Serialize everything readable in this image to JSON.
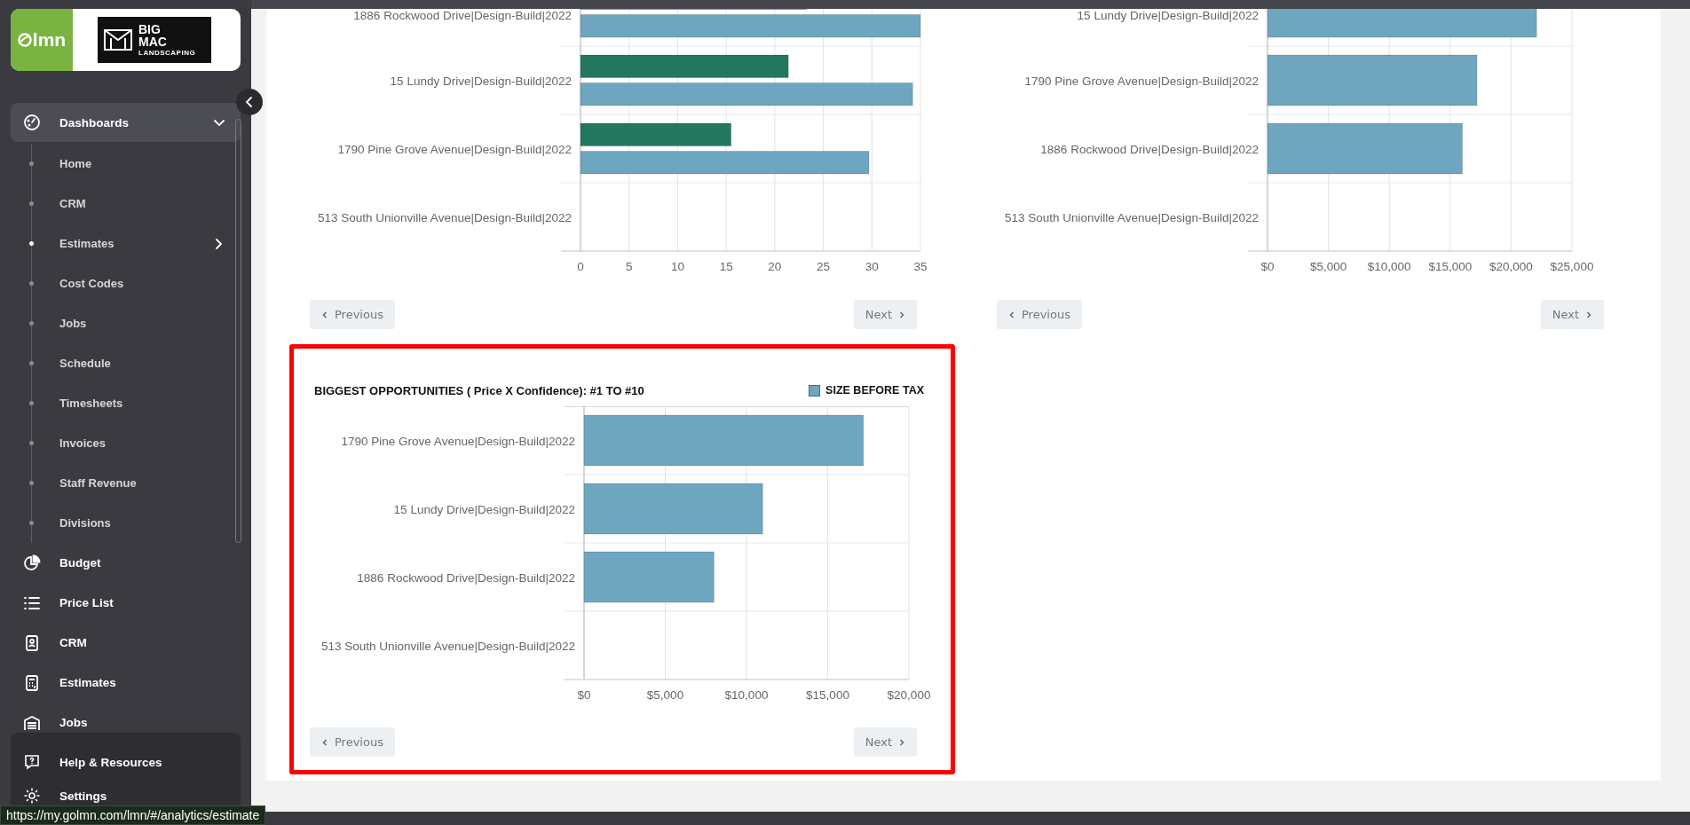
{
  "brand": {
    "logo_text": "lmn",
    "company_lines": [
      "BIG",
      "MAC",
      "LANDSCAPING"
    ]
  },
  "sidebar": {
    "items": [
      {
        "label": "Dashboards",
        "kind": "group",
        "selected": true,
        "expanded": true,
        "children": [
          {
            "label": "Home",
            "selected": false,
            "has_submenu": false
          },
          {
            "label": "CRM",
            "selected": false,
            "has_submenu": false
          },
          {
            "label": "Estimates",
            "selected": true,
            "has_submenu": true
          },
          {
            "label": "Cost Codes",
            "selected": false,
            "has_submenu": false
          },
          {
            "label": "Jobs",
            "selected": false,
            "has_submenu": false
          },
          {
            "label": "Schedule",
            "selected": false,
            "has_submenu": false
          },
          {
            "label": "Timesheets",
            "selected": false,
            "has_submenu": false
          },
          {
            "label": "Invoices",
            "selected": false,
            "has_submenu": false
          },
          {
            "label": "Staff Revenue",
            "selected": false,
            "has_submenu": false
          },
          {
            "label": "Divisions",
            "selected": false,
            "has_submenu": false
          }
        ]
      },
      {
        "label": "Budget",
        "kind": "link",
        "selected": false
      },
      {
        "label": "Price List",
        "kind": "link",
        "selected": false
      },
      {
        "label": "CRM",
        "kind": "link",
        "selected": false
      },
      {
        "label": "Estimates",
        "kind": "link",
        "selected": false
      },
      {
        "label": "Jobs",
        "kind": "link",
        "selected": false
      }
    ],
    "footer_items": [
      {
        "label": "Help & Resources"
      },
      {
        "label": "Settings"
      }
    ]
  },
  "charts": [
    {
      "highlighted": false,
      "chart_data": {
        "type": "bar",
        "orientation": "horizontal",
        "categories": [
          "1886 Rockwood Drive|Design-Build|2022",
          "15 Lundy Drive|Design-Build|2022",
          "1790 Pine Grove Avenue|Design-Build|2022",
          "513 South Unionville Avenue|Design-Build|2022"
        ],
        "series": [
          {
            "color": "#23775f",
            "values": [
              23.3,
              21.4,
              15.5,
              null
            ]
          },
          {
            "color": "#6ea6bf",
            "values": [
              35,
              34.2,
              29.7,
              null
            ]
          }
        ],
        "xlim": [
          0,
          35
        ],
        "grid": true,
        "xticks": [
          0,
          5,
          10,
          15,
          20,
          25,
          30,
          35
        ]
      },
      "buttons": [
        {
          "label": "Previous",
          "kind": "previous"
        },
        {
          "label": "Next",
          "kind": "next"
        }
      ]
    },
    {
      "highlighted": false,
      "chart_data": {
        "type": "bar",
        "orientation": "horizontal",
        "categories": [
          "15 Lundy Drive|Design-Build|2022",
          "1790 Pine Grove Avenue|Design-Build|2022",
          "1886 Rockwood Drive|Design-Build|2022",
          "513 South Unionville Avenue|Design-Build|2022"
        ],
        "series": [
          {
            "color": "#6ea6bf",
            "values": [
              22100,
              17200,
              16000,
              null
            ]
          }
        ],
        "xlim": [
          0,
          25000
        ],
        "grid": true,
        "xticks": [
          {
            "value": 0,
            "label": "$0"
          },
          {
            "value": 5000,
            "label": "$5,000"
          },
          {
            "value": 10000,
            "label": "$10,000"
          },
          {
            "value": 15000,
            "label": "$15,000"
          },
          {
            "value": 20000,
            "label": "$20,000"
          },
          {
            "value": 25000,
            "label": "$25,000"
          }
        ]
      },
      "buttons": [
        {
          "label": "Previous",
          "kind": "previous"
        },
        {
          "label": "Next",
          "kind": "next"
        }
      ]
    },
    {
      "highlighted": true,
      "chart_data": {
        "type": "bar",
        "orientation": "horizontal",
        "title": "BIGGEST OPPORTUNITIES ( Price X Confidence): #1 TO #10",
        "categories": [
          "1790 Pine Grove Avenue|Design-Build|2022",
          "15 Lundy Drive|Design-Build|2022",
          "1886 Rockwood Drive|Design-Build|2022",
          "513 South Unionville Avenue|Design-Build|2022"
        ],
        "series": [
          {
            "name": "SIZE BEFORE TAX",
            "color": "#6ea6bf",
            "values": [
              17200,
              11000,
              8000,
              null
            ]
          }
        ],
        "xlim": [
          0,
          20000
        ],
        "grid": true,
        "xticks": [
          {
            "value": 0,
            "label": "$0"
          },
          {
            "value": 5000,
            "label": "$5,000"
          },
          {
            "value": 10000,
            "label": "$10,000"
          },
          {
            "value": 15000,
            "label": "$15,000"
          },
          {
            "value": 20000,
            "label": "$20,000"
          }
        ]
      },
      "buttons": [
        {
          "label": "Previous",
          "kind": "previous"
        },
        {
          "label": "Next",
          "kind": "next"
        }
      ]
    }
  ],
  "status_url": "https://my.golmn.com/lmn/#/analytics/estimate"
}
